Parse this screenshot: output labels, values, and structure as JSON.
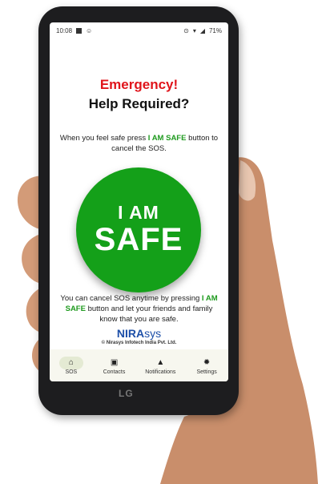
{
  "status_bar": {
    "time": "10:08",
    "battery": "71%"
  },
  "heading": {
    "line1": "Emergency!",
    "line2": "Help Required?"
  },
  "instruction": {
    "before": "When you feel safe press",
    "highlight": "I AM SAFE",
    "after": "button to cancel the SOS."
  },
  "safe_button": {
    "line1": "I AM",
    "line2": "SAFE"
  },
  "cancel_info": {
    "before": "You can cancel SOS anytime by pressing",
    "highlight": "I AM SAFE",
    "after": "button and let your friends and family know that you are safe."
  },
  "brand": {
    "logo_bold": "NIRA",
    "logo_rest": "sys",
    "copyright": "© Nirasys Infotech India Pvt. Ltd."
  },
  "nav": {
    "items": [
      {
        "label": "SOS",
        "icon": "home-icon",
        "active": true
      },
      {
        "label": "Contacts",
        "icon": "contacts-icon",
        "active": false
      },
      {
        "label": "Notifications",
        "icon": "bell-icon",
        "active": false
      },
      {
        "label": "Settings",
        "icon": "gear-icon",
        "active": false
      }
    ]
  },
  "device": {
    "brand_mark": "LG"
  },
  "colors": {
    "accent_green": "#14a019",
    "alert_red": "#e0141b",
    "brand_blue": "#1d4fa8"
  }
}
